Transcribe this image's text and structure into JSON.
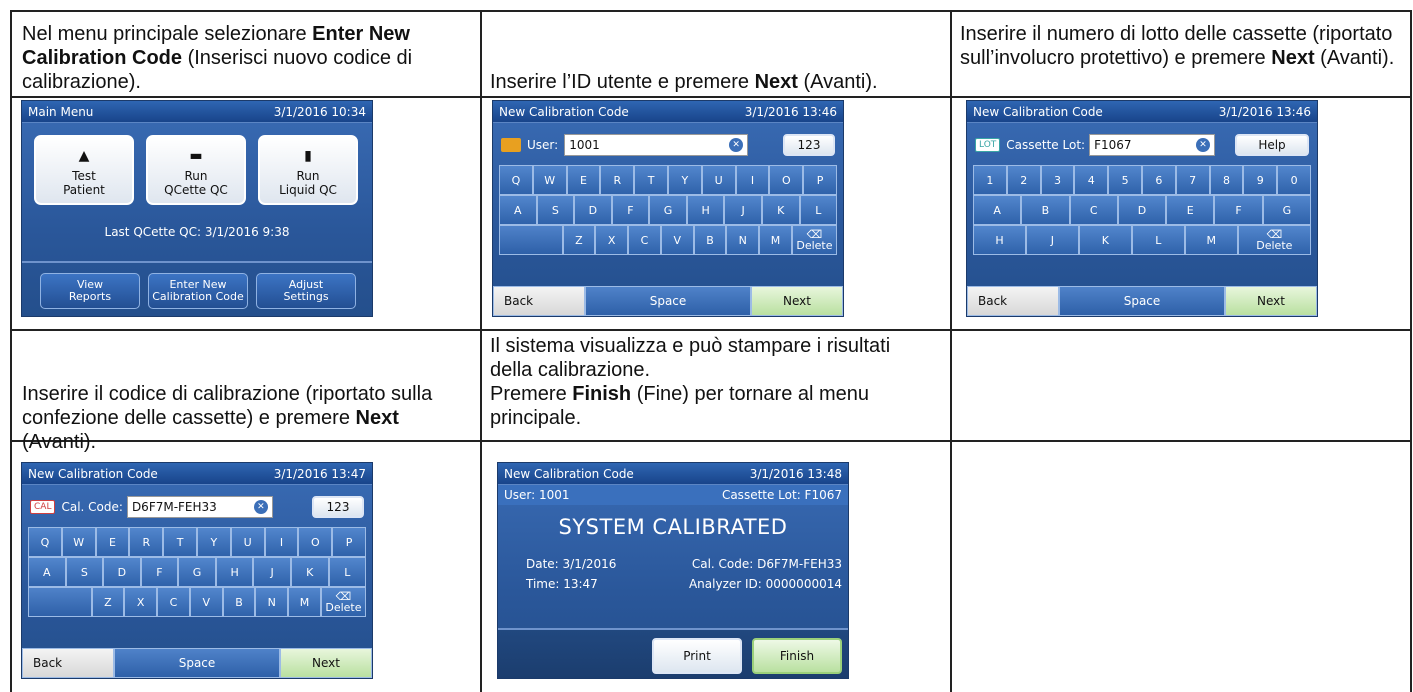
{
  "instructions": {
    "step1": {
      "pre": "Nel menu principale selezionare ",
      "bold": "Enter New Calibration Code",
      "post": " (Inserisci nuovo codice di calibrazione)."
    },
    "step2": {
      "pre": "Inserire l’ID utente e premere ",
      "bold": "Next",
      "post": " (Avanti)."
    },
    "step3": {
      "pre": "Inserire il numero di lotto delle cassette (riportato sull’involucro protettivo) e premere ",
      "bold": "Next",
      "post": " (Avanti)."
    },
    "step4": {
      "pre": "Inserire il codice di calibrazione (riportato sulla confezione delle cassette) e premere ",
      "bold": "Next",
      "post": " (Avanti)."
    },
    "step5": {
      "line1": "Il sistema visualizza e può stampare i risultati della calibrazione.",
      "pre": "Premere ",
      "bold": "Finish",
      "post": " (Fine) per tornare al menu principale."
    }
  },
  "main_menu": {
    "title": "Main Menu",
    "datetime": "3/1/2016 10:34",
    "buttons": [
      {
        "line1": "Test",
        "line2": "Patient",
        "icon": "blood-drop-icon"
      },
      {
        "line1": "Run",
        "line2": "QCette QC",
        "icon": "qcette-icon"
      },
      {
        "line1": "Run",
        "line2": "Liquid QC",
        "icon": "vial-icon"
      }
    ],
    "last_qc": "Last QCette QC: 3/1/2016 9:38",
    "bottom": [
      {
        "line1": "View",
        "line2": "Reports"
      },
      {
        "line1": "Enter New",
        "line2": "Calibration Code"
      },
      {
        "line1": "Adjust",
        "line2": "Settings"
      }
    ]
  },
  "user_screen": {
    "title": "New Calibration Code",
    "datetime": "3/1/2016 13:46",
    "label": "User:",
    "value": "1001",
    "mode": "123"
  },
  "lot_screen": {
    "title": "New Calibration Code",
    "datetime": "3/1/2016 13:46",
    "tag": "LOT",
    "label": "Cassette Lot:",
    "value": "F1067",
    "help": "Help"
  },
  "code_screen": {
    "title": "New Calibration Code",
    "datetime": "3/1/2016 13:47",
    "tag": "CAL",
    "label": "Cal. Code:",
    "value": "D6F7M-FEH33",
    "mode": "123"
  },
  "result_screen": {
    "title": "New Calibration Code",
    "datetime": "3/1/2016 13:48",
    "user": "User: 1001",
    "lot": "Cassette Lot: F1067",
    "headline": "SYSTEM CALIBRATED",
    "date": "Date: 3/1/2016",
    "code": "Cal. Code: D6F7M-FEH33",
    "time": "Time: 13:47",
    "analyzer": "Analyzer ID: 0000000014",
    "print": "Print",
    "finish": "Finish"
  },
  "keyboard": {
    "row1": [
      "Q",
      "W",
      "E",
      "R",
      "T",
      "Y",
      "U",
      "I",
      "O",
      "P"
    ],
    "row2": [
      "A",
      "S",
      "D",
      "F",
      "G",
      "H",
      "J",
      "K",
      "L"
    ],
    "row3": [
      "",
      "Z",
      "X",
      "C",
      "V",
      "B",
      "N",
      "M",
      "Delete"
    ],
    "num_row1": [
      "1",
      "2",
      "3",
      "4",
      "5",
      "6",
      "7",
      "8",
      "9",
      "0"
    ],
    "num_row2": [
      "A",
      "B",
      "C",
      "D",
      "E",
      "F",
      "G"
    ],
    "num_row3": [
      "H",
      "J",
      "K",
      "L",
      "M",
      "Delete"
    ],
    "back": "Back",
    "space": "Space",
    "next": "Next"
  },
  "colors": {
    "screen_blue": "#2a579a",
    "next_green": "#b9e0a0",
    "lot_tag": "#3aa6a6",
    "cal_tag": "#d04040",
    "user_tag": "#e8a020"
  }
}
